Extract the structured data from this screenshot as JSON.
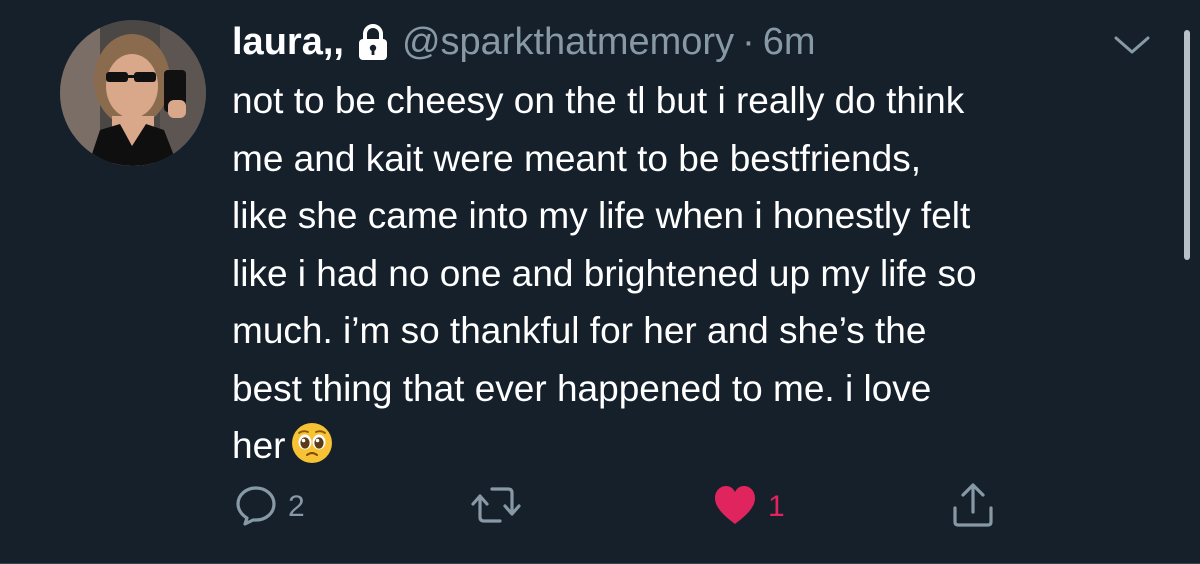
{
  "tweet": {
    "display_name": "laura,,",
    "handle": "@sparkthatmemory",
    "separator": "·",
    "time": "6m",
    "text": "not to be cheesy on the tl but i really do think\nme and kait were meant to be bestfriends,\nlike she came into my life when i honestly felt\nlike i had no one and brightened up my life so\nmuch. i’m so thankful for her and she’s the\nbest thing that ever happened to me. i love\nher",
    "emoji": "pleading-face-emoji",
    "protected_icon": "lock-icon",
    "menu_icon": "chevron-down-icon"
  },
  "actions": {
    "reply": {
      "icon": "reply-icon",
      "count": "2"
    },
    "retweet": {
      "icon": "retweet-icon",
      "count": ""
    },
    "like": {
      "icon": "heart-icon",
      "count": "1"
    },
    "share": {
      "icon": "share-icon",
      "count": ""
    }
  },
  "colors": {
    "background": "#15202b",
    "text_primary": "#ffffff",
    "text_secondary": "#8899a6",
    "like_active": "#e0245e"
  }
}
